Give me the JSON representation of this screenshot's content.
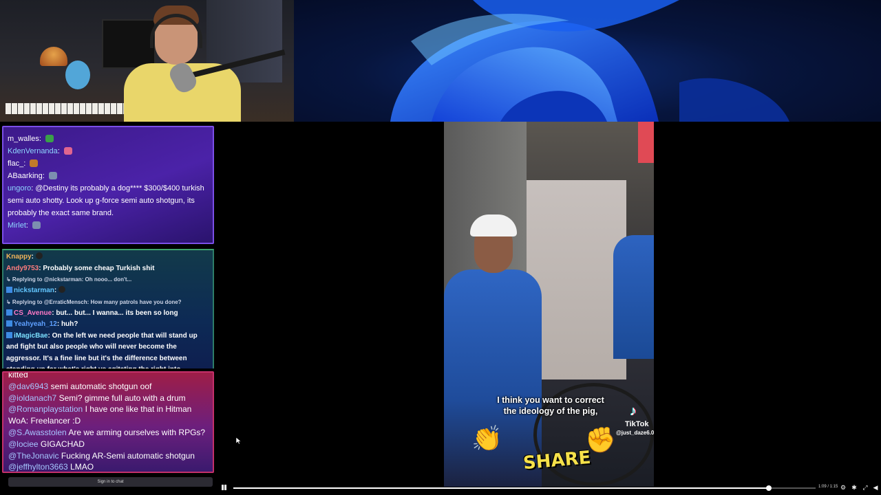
{
  "chat_top": {
    "messages": [
      {
        "user": "m_walles",
        "text": "",
        "color": "#ffffff",
        "emote_color": "#3aa049"
      },
      {
        "user": "KdenVernanda",
        "text": "",
        "color": "#8fd7ff",
        "emote_color": "#e0658f"
      },
      {
        "user": "flac_",
        "text": "",
        "color": "#ffffff",
        "emote_color": "#c27a2a"
      },
      {
        "user": "ABaarking",
        "text": "",
        "color": "#ffffff",
        "emote_color": "#7c8fb0"
      },
      {
        "user": "ungoro",
        "text": "@Destiny its probably a dog**** $300/$400 turkish semi auto shotty. Look up g-force semi auto shotgun, its probably the exact same brand.",
        "color": "#8fd7ff",
        "emote_color": ""
      },
      {
        "user": "Mirlet",
        "text": "",
        "color": "#8fd7ff",
        "emote_color": "#7c8fb0"
      }
    ]
  },
  "chat_mid": {
    "lines": [
      {
        "user": "Knappy",
        "text": "",
        "color": "#f0b35a",
        "reply": ""
      },
      {
        "user": "Andy9753",
        "text": "Probably some cheap Turkish shit",
        "color": "#ff7d7d",
        "reply": ""
      },
      {
        "user": "nickstarman",
        "text": "",
        "color": "#63c6ff",
        "reply": "Replying to @nickstarman: Oh nooo... don't..."
      },
      {
        "user": "CS_Avenue",
        "text": "but... but... I wanna... its been so long",
        "color": "#ff79c6",
        "reply": "Replying to @ErraticMensch: How many patrols have you done?"
      },
      {
        "user": "Yeahyeah_12",
        "text": "huh?",
        "color": "#5fa0ff",
        "reply": ""
      },
      {
        "user": "iMagicBae",
        "text": "On the left we need people that will stand up and fight but also people who will never become the aggressor. It's a fine line but it's the difference between standing up for what's right vs agitating the right into becoming even more violent",
        "color": "#7ce0ff",
        "reply": ""
      }
    ]
  },
  "chat_bottom": {
    "messages": [
      {
        "user": "",
        "text": "kitted"
      },
      {
        "user": "@dav6943",
        "text": "semi automatic shotgun oof"
      },
      {
        "user": "@ioldanach7",
        "text": "Semi? gimme full auto with a drum"
      },
      {
        "user": "@Romanplaystation",
        "text": "I have one like that in Hitman WoA: Freelancer :D"
      },
      {
        "user": "@S.Awasstolen",
        "text": "Are we arming ourselves with RPGs?"
      },
      {
        "user": "@lociee",
        "text": "GIGACHAD"
      },
      {
        "user": "@TheJonavic",
        "text": "Fucking AR-Semi automatic shotgun"
      },
      {
        "user": "@jeffhylton3663",
        "text": "LMAO"
      }
    ],
    "signin_label": "Sign in to chat"
  },
  "video": {
    "caption_line1": "I think you want to correct",
    "caption_line2": "the ideology of the pig,",
    "tiktok_label": "TikTok",
    "tiktok_user": "@just_daze6.0",
    "share_label": "SHARE"
  },
  "player": {
    "time": "1:09 / 1:15",
    "progress": 0.92
  }
}
